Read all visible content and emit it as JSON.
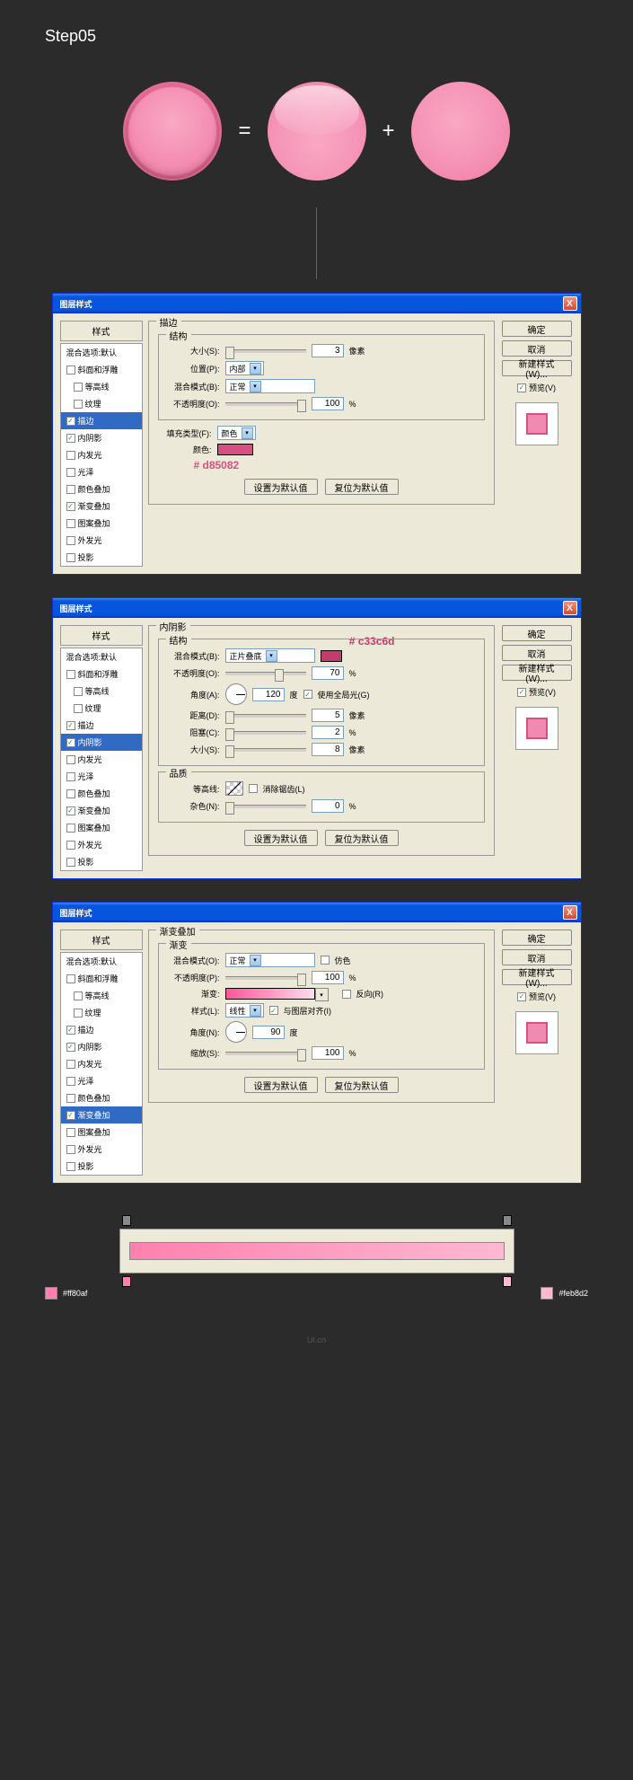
{
  "step": "Step05",
  "op_eq": "=",
  "op_plus": "+",
  "dialog_title": "图层样式",
  "close_x": "X",
  "styles_header": "样式",
  "blend_default": "混合选项:默认",
  "style_items": [
    {
      "label": "斜面和浮雕",
      "checked": false
    },
    {
      "label": "等高线",
      "checked": false,
      "sub": true
    },
    {
      "label": "纹理",
      "checked": false,
      "sub": true
    },
    {
      "label": "描边",
      "checked": true
    },
    {
      "label": "内阴影",
      "checked": true
    },
    {
      "label": "内发光",
      "checked": false
    },
    {
      "label": "光泽",
      "checked": false
    },
    {
      "label": "颜色叠加",
      "checked": false
    },
    {
      "label": "渐变叠加",
      "checked": true
    },
    {
      "label": "图案叠加",
      "checked": false
    },
    {
      "label": "外发光",
      "checked": false
    },
    {
      "label": "投影",
      "checked": false
    }
  ],
  "right": {
    "ok": "确定",
    "cancel": "取消",
    "new_style": "新建样式(W)...",
    "preview": "预览(V)"
  },
  "btn_set_default": "设置为默认值",
  "btn_reset_default": "复位为默认值",
  "d1": {
    "panel_title": "描边",
    "struct": "结构",
    "size": "大小(S):",
    "size_val": "3",
    "px": "像素",
    "pos": "位置(P):",
    "pos_val": "内部",
    "blend": "混合模式(B):",
    "blend_val": "正常",
    "opacity": "不透明度(O):",
    "opacity_val": "100",
    "pct": "%",
    "fill_type": "填充类型(F):",
    "fill_val": "颜色",
    "color": "颜色:",
    "color_hex": "# d85082",
    "swatch": "#d85082"
  },
  "d2": {
    "panel_title": "内阴影",
    "struct": "结构",
    "quality": "品质",
    "anno": "# c33c6d",
    "blend": "混合模式(B):",
    "blend_val": "正片叠底",
    "swatch": "#c33c6d",
    "opacity": "不透明度(O):",
    "opacity_val": "70",
    "pct": "%",
    "angle": "角度(A):",
    "angle_val": "120",
    "deg": "度",
    "global": "使用全局光(G)",
    "dist": "距离(D):",
    "dist_val": "5",
    "px": "像素",
    "choke": "阻塞(C):",
    "choke_val": "2",
    "pct2": "%",
    "size": "大小(S):",
    "size_val": "8",
    "contour": "等高线:",
    "anti": "消除锯齿(L)",
    "noise": "杂色(N):",
    "noise_val": "0"
  },
  "d3": {
    "panel_title": "渐变叠加",
    "grad": "渐变",
    "blend": "混合模式(O):",
    "blend_val": "正常",
    "dither": "仿色",
    "opacity": "不透明度(P):",
    "opacity_val": "100",
    "pct": "%",
    "gradient": "渐变:",
    "reverse": "反向(R)",
    "style": "样式(L):",
    "style_val": "线性",
    "align": "与图层对齐(I)",
    "angle": "角度(N):",
    "angle_val": "90",
    "deg": "度",
    "scale": "缩放(S):",
    "scale_val": "100"
  },
  "swatches": {
    "c1": "#ff80af",
    "c2": "#feb8d2"
  },
  "wm": "UI.cn"
}
